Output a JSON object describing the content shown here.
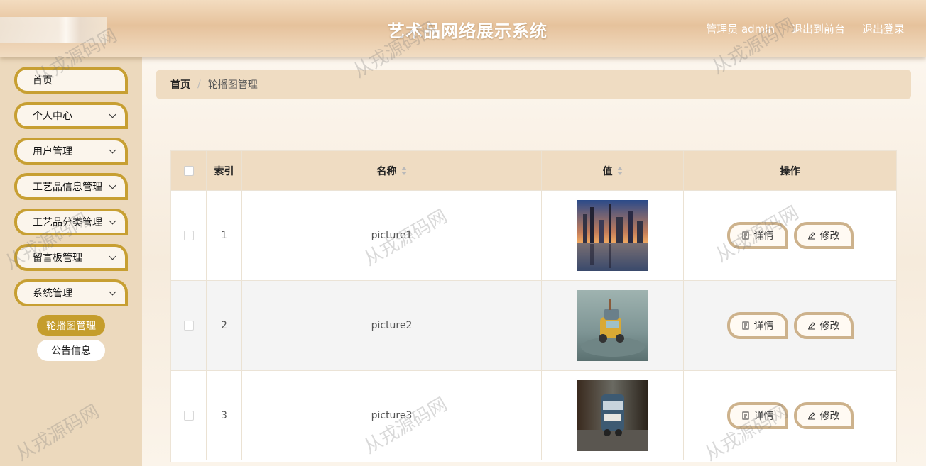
{
  "header": {
    "title": "艺术品网络展示系统",
    "user_label": "管理员 admin",
    "to_frontend": "退出到前台",
    "logout": "退出登录"
  },
  "sidebar": {
    "items": [
      {
        "label": "首页",
        "has_chevron": false
      },
      {
        "label": "个人中心",
        "has_chevron": true
      },
      {
        "label": "用户管理",
        "has_chevron": true
      },
      {
        "label": "工艺品信息管理",
        "has_chevron": true
      },
      {
        "label": "工艺品分类管理",
        "has_chevron": true
      },
      {
        "label": "留言板管理",
        "has_chevron": true
      },
      {
        "label": "系统管理",
        "has_chevron": true
      }
    ],
    "sub_items": [
      {
        "label": "轮播图管理",
        "active": true
      },
      {
        "label": "公告信息",
        "active": false
      }
    ]
  },
  "breadcrumb": {
    "home": "首页",
    "separator": "/",
    "current": "轮播图管理"
  },
  "table": {
    "columns": {
      "index": "索引",
      "name": "名称",
      "value": "值",
      "actions": "操作"
    },
    "rows": [
      {
        "index": "1",
        "name": "picture1",
        "image": "city skyline at sunset"
      },
      {
        "index": "2",
        "name": "picture2",
        "image": "toy car on stone"
      },
      {
        "index": "3",
        "name": "picture3",
        "image": "toy bus in motion"
      }
    ],
    "detail_label": "详情",
    "edit_label": "修改"
  },
  "watermark": "从戎源码网",
  "colors": {
    "accent_gold": "#c79f32",
    "header_tan": "#e6c29c",
    "sidebar_bg": "#ecd9bd",
    "table_header": "#efdcc2",
    "button_border": "#cdb28c"
  }
}
